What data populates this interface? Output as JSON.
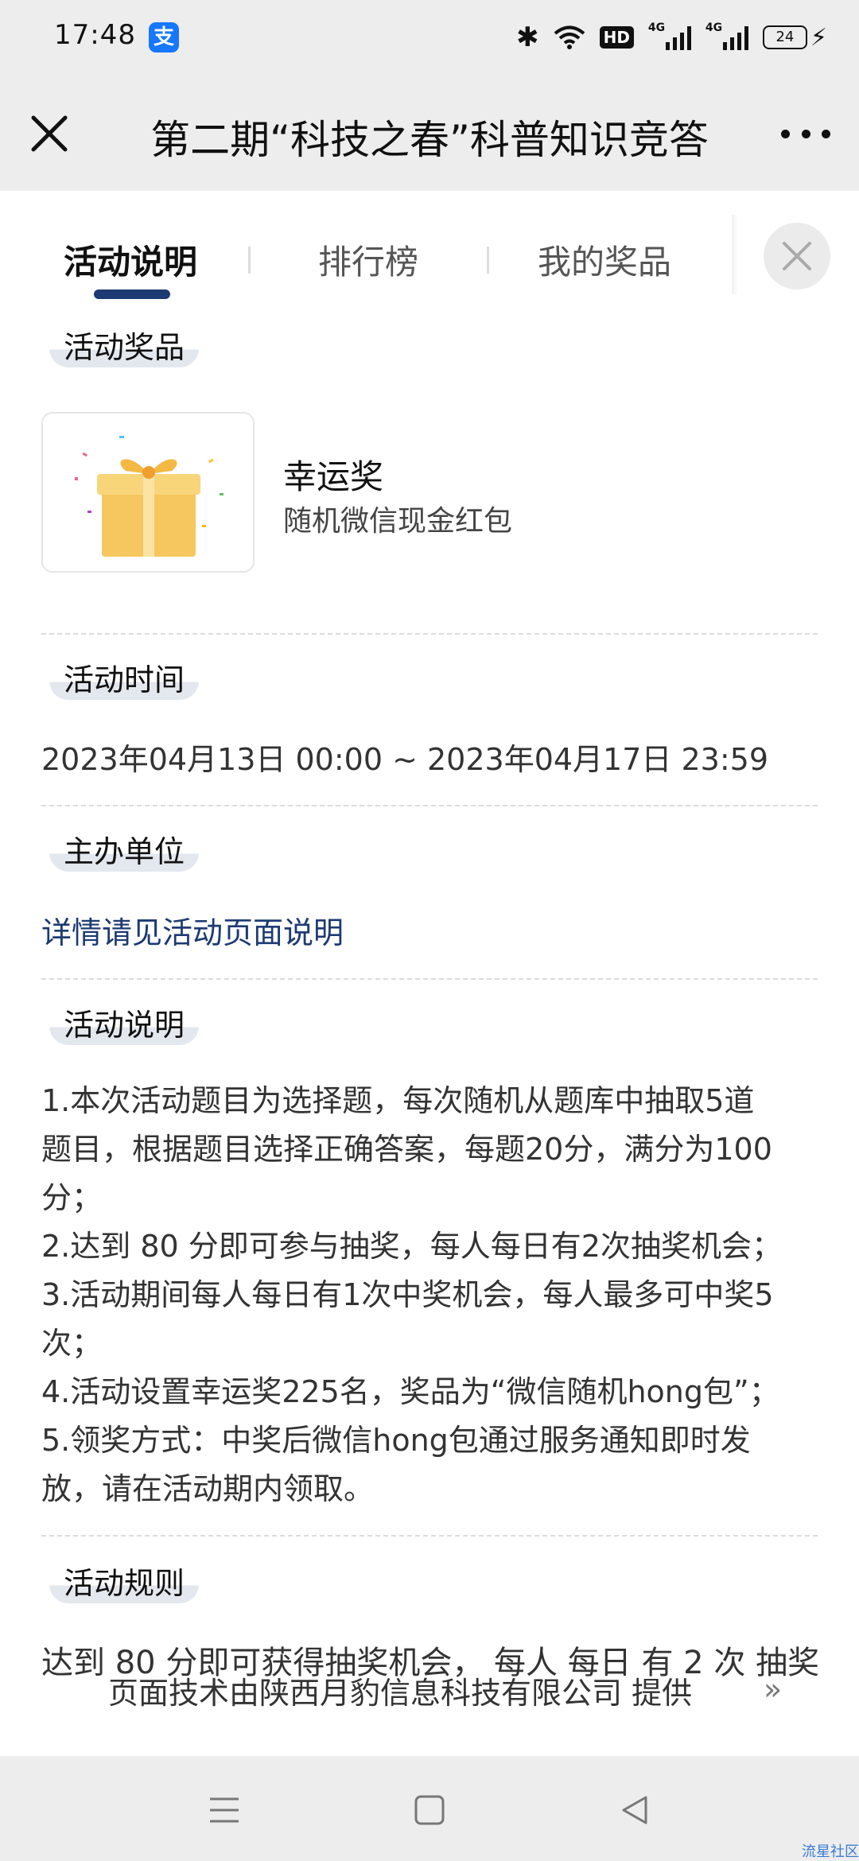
{
  "status_bar": {
    "time": "17:48",
    "app_icon": "alipay-icon",
    "app_icon_glyph": "支",
    "hd_label": "HD",
    "signal_label": "4G",
    "battery_level": "24",
    "icons": [
      "bluetooth-icon",
      "wifi-icon",
      "hd-icon",
      "signal-icon",
      "battery-icon",
      "charging-icon"
    ]
  },
  "title_bar": {
    "title": "第二期“科技之春”科普知识竞答",
    "close_icon": "close-icon",
    "more_icon": "more-icon"
  },
  "tabs": {
    "items": [
      {
        "label": "活动说明",
        "active": true
      },
      {
        "label": "排行榜",
        "active": false
      },
      {
        "label": "我的奖品",
        "active": false
      }
    ],
    "close_icon": "close-icon"
  },
  "prizes": {
    "heading": "活动奖品",
    "items": [
      {
        "name": "幸运奖",
        "description": "随机微信现金红包",
        "icon": "gift-icon"
      }
    ]
  },
  "activity_time": {
    "heading": "活动时间",
    "text": "2023年04月13日 00:00 ~ 2023年04月17日 23:59"
  },
  "organizer": {
    "heading": "主办单位",
    "link_text": "详情请见活动页面说明"
  },
  "description": {
    "heading": "活动说明",
    "lines": [
      "1.本次活动题目为选择题，每次随机从题库中抽取5道",
      "题目，根据题目选择正确答案，每题20分，满分为100",
      "分；",
      "2.达到 80 分即可参与抽奖，每人每日有2次抽奖机会；",
      "3.活动期间每人每日有1次中奖机会，每人最多可中奖5",
      "次；",
      "4.活动设置幸运奖225名，奖品为“微信随机hong包”；",
      "5.领奖方式：中奖后微信hong包通过服务通知即时发",
      "放，请在活动期内领取。"
    ]
  },
  "rules": {
    "heading": "活动规则",
    "text": "达到 80 分即可获得抽奖机会， 每人 每日 有 2 次 抽奖"
  },
  "footer": {
    "text": "页面技术由陕西月豹信息科技有限公司 提供",
    "arrow": "»"
  },
  "nav_bar": {
    "icons": [
      "menu-icon",
      "home-icon",
      "back-icon"
    ],
    "watermark": "流星社区"
  },
  "colors": {
    "accent": "#1d3a73",
    "label_bg": "#e3e7ee",
    "bar_bg": "#ededed",
    "app_icon": "#1677ff"
  }
}
